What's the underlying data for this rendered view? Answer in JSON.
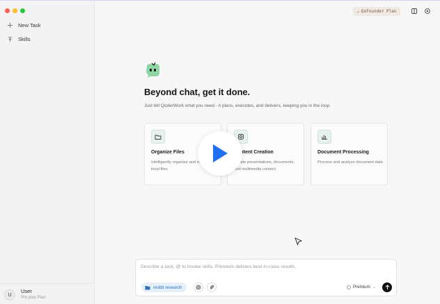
{
  "sidebar": {
    "items": [
      {
        "label": "New Task",
        "icon": "plus-icon"
      },
      {
        "label": "Skills",
        "icon": "skills-icon"
      }
    ],
    "user": {
      "avatar_letter": "U",
      "name": "User",
      "plan": "Pro plus Plan"
    }
  },
  "topbar": {
    "plan_chip": "QoFounder Plan",
    "icons": [
      "book-icon",
      "gear-icon"
    ]
  },
  "main": {
    "headline": "Beyond chat, get it done.",
    "subline": "Just tell QoderWork what you need - it plans, executes, and delivers, keeping you in the loop.",
    "cards": [
      {
        "title": "Organize Files",
        "desc": "Intelligently organize and manage local files",
        "icon": "folder-icon"
      },
      {
        "title": "Content Creation",
        "desc": "Create presentations, documents, and multimedia content",
        "icon": "instagram-icon"
      },
      {
        "title": "Document Processing",
        "desc": "Process and analyze document data",
        "icon": "chart-icon"
      }
    ]
  },
  "composer": {
    "placeholder": "Describe a task, @ to invoke skills. Premium delivers best-in-class results.",
    "skill_chip": "reddit research",
    "model": "Premium"
  },
  "colors": {
    "accent_blue": "#2b6fb8",
    "play_blue": "#1f6ff0",
    "mascot_green": "#8fd6a4",
    "card_icon_bg": "#e8f2ec"
  }
}
